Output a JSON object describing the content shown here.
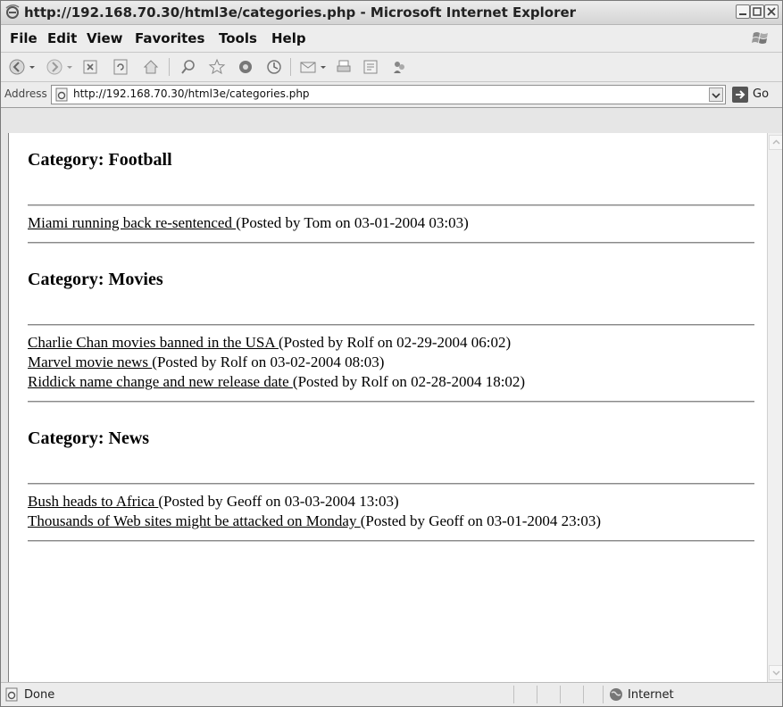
{
  "window": {
    "title": "http://192.168.70.30/html3e/categories.php - Microsoft Internet Explorer"
  },
  "menu": {
    "items": [
      "File",
      "Edit",
      "View",
      "Favorites",
      "Tools",
      "Help"
    ]
  },
  "toolbar": {
    "icons": [
      "back-icon",
      "forward-icon",
      "stop-icon",
      "refresh-icon",
      "home-icon",
      "search-icon",
      "favorites-icon",
      "media-icon",
      "history-icon",
      "mail-icon",
      "print-icon",
      "edit-icon",
      "messenger-icon"
    ]
  },
  "address": {
    "label": "Address",
    "url": "http://192.168.70.30/html3e/categories.php",
    "go_label": "Go"
  },
  "page": {
    "categories": [
      {
        "heading": "Category: Football",
        "posts": [
          {
            "link": "Miami running back re-sentenced ",
            "meta": "(Posted by Tom on 03-01-2004 03:03)"
          }
        ]
      },
      {
        "heading": "Category: Movies",
        "posts": [
          {
            "link": "Charlie Chan movies banned in the USA ",
            "meta": "(Posted by Rolf on 02-29-2004 06:02)"
          },
          {
            "link": "Marvel movie news ",
            "meta": "(Posted by Rolf on 03-02-2004 08:03)"
          },
          {
            "link": "Riddick name change and new release date ",
            "meta": "(Posted by Rolf on 02-28-2004 18:02)"
          }
        ]
      },
      {
        "heading": "Category: News",
        "posts": [
          {
            "link": "Bush heads to Africa ",
            "meta": "(Posted by Geoff on 03-03-2004 13:03)"
          },
          {
            "link": "Thousands of Web sites might be attacked on Monday ",
            "meta": "(Posted by Geoff on 03-01-2004 23:03)"
          }
        ]
      }
    ]
  },
  "status": {
    "text": "Done",
    "zone": "Internet"
  }
}
